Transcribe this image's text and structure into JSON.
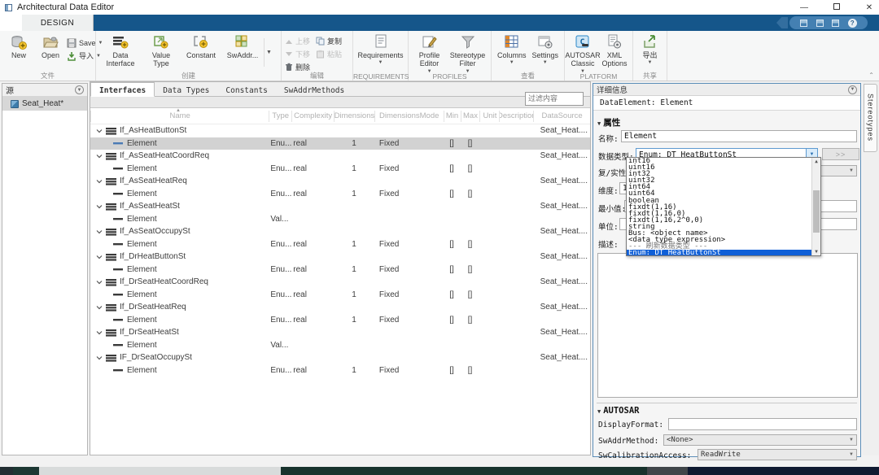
{
  "window": {
    "title": "Architectural Data Editor"
  },
  "ribbon": {
    "tab": "DESIGN",
    "file": {
      "label": "文件",
      "new": "New",
      "open": "Open",
      "save": "Save",
      "import": "导入"
    },
    "create": {
      "label": "创建",
      "data_interface": "Data Interface",
      "value_type": "Value Type",
      "constant": "Constant",
      "swaddr": "SwAddr..."
    },
    "edit": {
      "label": "编辑",
      "move_up": "上移",
      "move_down": "下移",
      "delete": "删除",
      "copy": "复制",
      "paste": "粘贴"
    },
    "requirements": {
      "label": "REQUIREMENTS",
      "requirements": "Requirements"
    },
    "profiles": {
      "label": "PROFILES",
      "profile_editor": "Profile Editor",
      "stereotype_filter": "Stereotype Filter"
    },
    "view": {
      "label": "查看",
      "columns": "Columns",
      "settings": "Settings"
    },
    "platform": {
      "label": "PLATFORM",
      "autosar_classic": "AUTOSAR Classic",
      "xml_options": "XML Options"
    },
    "share": {
      "label": "共享",
      "export": "导出"
    }
  },
  "source_panel": {
    "title": "源",
    "items": [
      {
        "label": "Seat_Heat*",
        "selected": true
      }
    ]
  },
  "editor_tabs": [
    {
      "label": "Interfaces",
      "selected": true
    },
    {
      "label": "Data Types",
      "selected": false
    },
    {
      "label": "Constants",
      "selected": false
    },
    {
      "label": "SwAddrMethods",
      "selected": false
    }
  ],
  "filter": {
    "placeholder": "过滤内容"
  },
  "table": {
    "columns": [
      "Name",
      "Type",
      "Complexity",
      "Dimensions",
      "DimensionsMode",
      "Min",
      "Max",
      "Unit",
      "Description",
      "DataSource"
    ],
    "rows": [
      {
        "kind": "group",
        "name": "If_AsHeatButtonSt",
        "datasource": "Seat_Heat...."
      },
      {
        "kind": "element",
        "name": "Element",
        "type": "Enu...",
        "complexity": "real",
        "dimensions": "1",
        "dimensionsmode": "Fixed",
        "min": "[]",
        "max": "[]",
        "selected": true
      },
      {
        "kind": "group",
        "name": "If_AsSeatHeatCoordReq",
        "datasource": "Seat_Heat...."
      },
      {
        "kind": "element",
        "name": "Element",
        "type": "Enu...",
        "complexity": "real",
        "dimensions": "1",
        "dimensionsmode": "Fixed",
        "min": "[]",
        "max": "[]"
      },
      {
        "kind": "group",
        "name": "If_AsSeatHeatReq",
        "datasource": "Seat_Heat...."
      },
      {
        "kind": "element",
        "name": "Element",
        "type": "Enu...",
        "complexity": "real",
        "dimensions": "1",
        "dimensionsmode": "Fixed",
        "min": "[]",
        "max": "[]"
      },
      {
        "kind": "group",
        "name": "If_AsSeatHeatSt",
        "datasource": "Seat_Heat...."
      },
      {
        "kind": "element",
        "name": "Element",
        "type": "Val...",
        "complexity": "",
        "dimensions": "",
        "dimensionsmode": "",
        "min": "",
        "max": ""
      },
      {
        "kind": "group",
        "name": "If_AsSeatOccupySt",
        "datasource": "Seat_Heat...."
      },
      {
        "kind": "element",
        "name": "Element",
        "type": "Enu...",
        "complexity": "real",
        "dimensions": "1",
        "dimensionsmode": "Fixed",
        "min": "[]",
        "max": "[]"
      },
      {
        "kind": "group",
        "name": "If_DrHeatButtonSt",
        "datasource": "Seat_Heat...."
      },
      {
        "kind": "element",
        "name": "Element",
        "type": "Enu...",
        "complexity": "real",
        "dimensions": "1",
        "dimensionsmode": "Fixed",
        "min": "[]",
        "max": "[]"
      },
      {
        "kind": "group",
        "name": "If_DrSeatHeatCoordReq",
        "datasource": "Seat_Heat...."
      },
      {
        "kind": "element",
        "name": "Element",
        "type": "Enu...",
        "complexity": "real",
        "dimensions": "1",
        "dimensionsmode": "Fixed",
        "min": "[]",
        "max": "[]"
      },
      {
        "kind": "group",
        "name": "If_DrSeatHeatReq",
        "datasource": "Seat_Heat...."
      },
      {
        "kind": "element",
        "name": "Element",
        "type": "Enu...",
        "complexity": "real",
        "dimensions": "1",
        "dimensionsmode": "Fixed",
        "min": "[]",
        "max": "[]"
      },
      {
        "kind": "group",
        "name": "If_DrSeatHeatSt",
        "datasource": "Seat_Heat...."
      },
      {
        "kind": "element",
        "name": "Element",
        "type": "Val...",
        "complexity": "",
        "dimensions": "",
        "dimensionsmode": "",
        "min": "",
        "max": ""
      },
      {
        "kind": "group",
        "name": "IF_DrSeatOccupySt",
        "datasource": "Seat_Heat...."
      },
      {
        "kind": "element",
        "name": "Element",
        "type": "Enu...",
        "complexity": "real",
        "dimensions": "1",
        "dimensionsmode": "Fixed",
        "min": "[]",
        "max": "[]"
      }
    ]
  },
  "details": {
    "title": "详细信息",
    "selection": "DataElement: Element",
    "properties": {
      "label": "属性",
      "name_label": "名称:",
      "name": "Element",
      "datatype_label": "数据类型:",
      "datatype": "Enum: DT HeatButtonSt",
      "more": ">>",
      "complexity_label": "复/实性:",
      "dimensions_label": "维度:",
      "dimensions": "1",
      "min_label": "最小值:",
      "min": "[]",
      "unit_label": "单位:",
      "unit": "",
      "description_label": "描述:",
      "description": ""
    },
    "datatype_dropdown": {
      "items": [
        "int16",
        "uint16",
        "int32",
        "uint32",
        "int64",
        "uint64",
        "boolean",
        "fixdt(1,16)",
        "fixdt(1,16,0)",
        "fixdt(1,16,2^0,0)",
        "string",
        "Bus: <object name>",
        "<data type expression>",
        "--- 刷新数据类型 ---",
        "Enum: DT HeatButtonSt"
      ],
      "selected": "Enum: DT HeatButtonSt"
    },
    "autosar": {
      "label": "AUTOSAR",
      "displayformat_label": "DisplayFormat:",
      "displayformat": "",
      "swaddrmethod_label": "SwAddrMethod:",
      "swaddrmethod": "<None>",
      "swcalibrationaccess_label": "SwCalibrationAccess:",
      "swcalibrationaccess": "ReadWrite"
    }
  },
  "stereotypes_tab": "Stereotypes"
}
